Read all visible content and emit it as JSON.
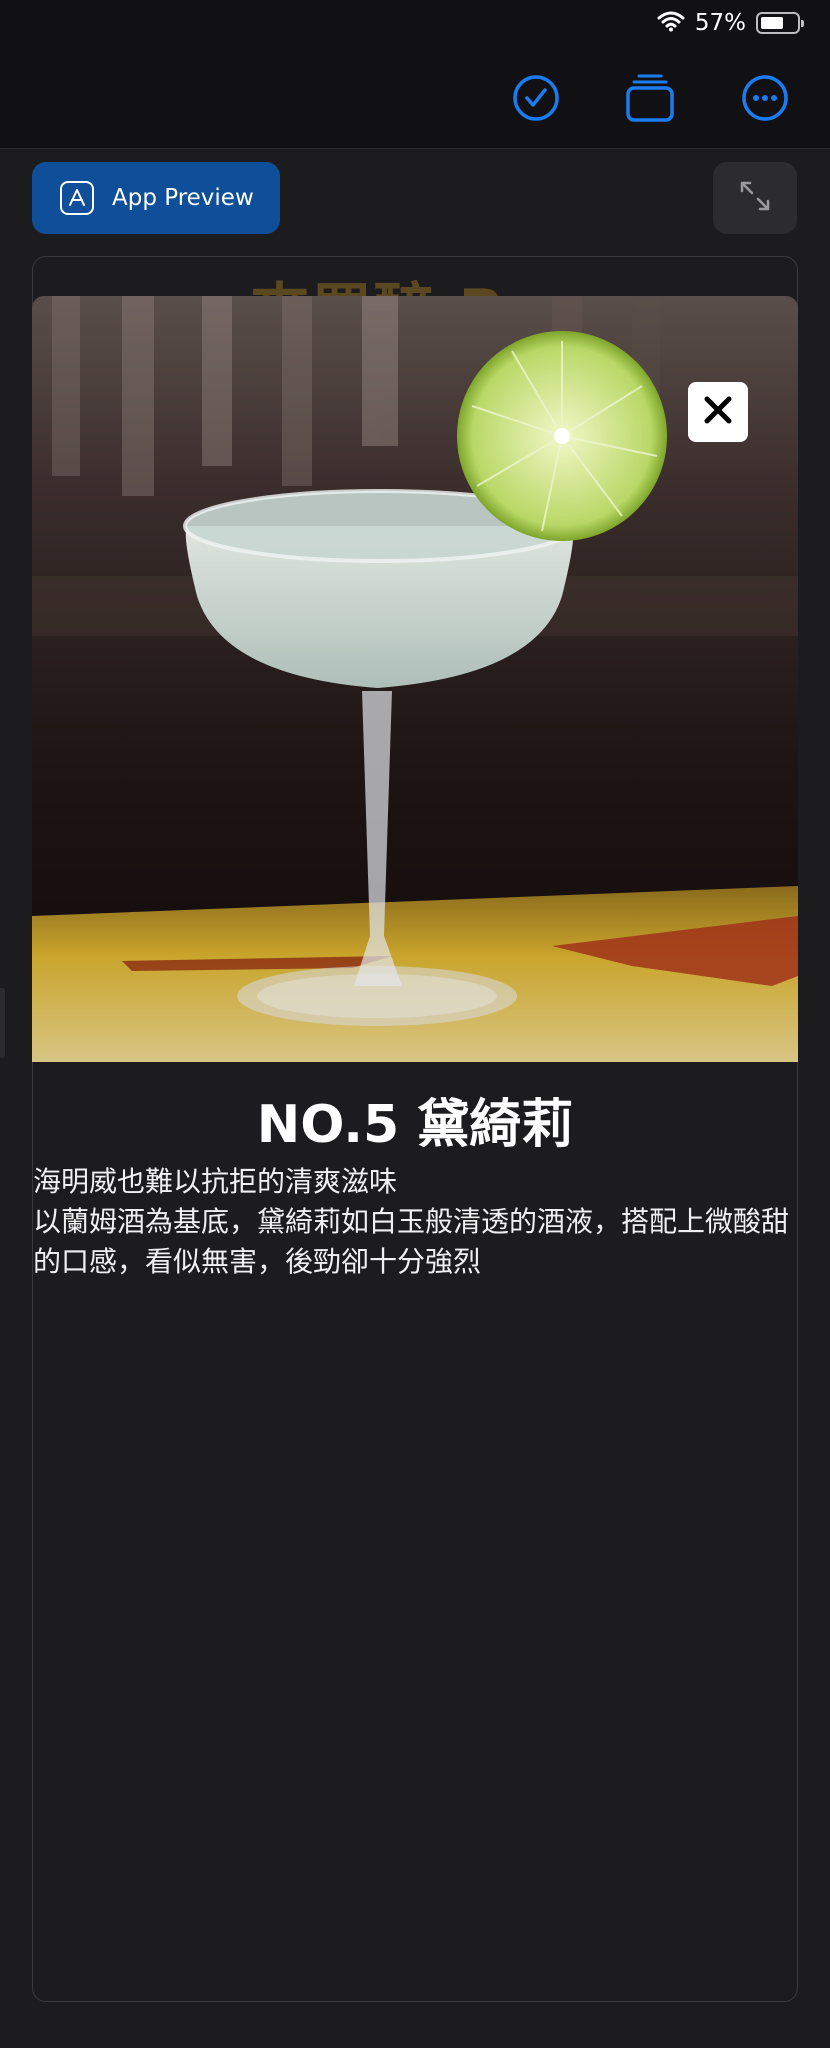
{
  "status": {
    "battery_percent": "57%",
    "battery_level": 0.57
  },
  "toolbar": {
    "icons": [
      "checkmark-circle-icon",
      "layers-icon",
      "more-circle-icon"
    ],
    "accent": "#1a7cf0"
  },
  "preview_button": {
    "label": "App Preview",
    "color": "#0f4f99"
  },
  "background_title": "來買醉 Bar",
  "drink": {
    "title": "NO.5 黛綺莉",
    "description": [
      "海明威也難以抗拒的清爽滋味",
      "以蘭姆酒為基底，黛綺莉如白玉般清透的酒液，搭配上微酸甜的口感，看似無害，後勁卻十分強烈"
    ]
  }
}
